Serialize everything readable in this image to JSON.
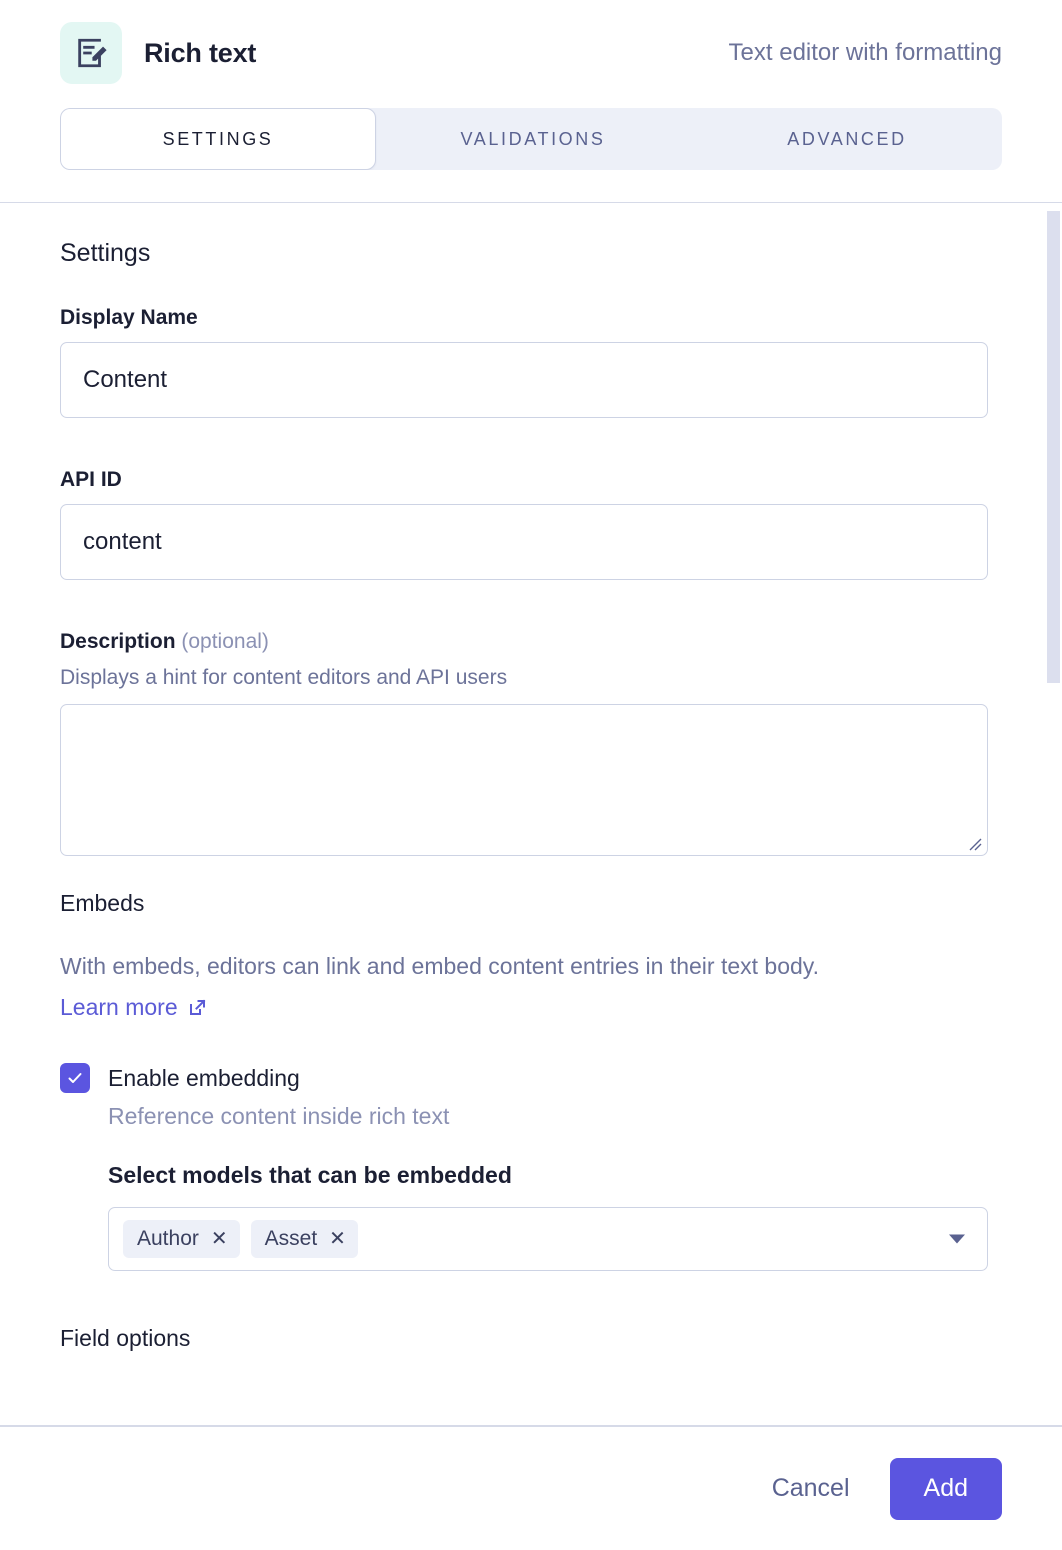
{
  "header": {
    "icon": "rich-text-document-pencil-icon",
    "title": "Rich text",
    "subtitle": "Text editor with formatting",
    "icon_bg": "#e3f7f3"
  },
  "tabs": [
    {
      "label": "SETTINGS",
      "active": true
    },
    {
      "label": "VALIDATIONS",
      "active": false
    },
    {
      "label": "ADVANCED",
      "active": false
    }
  ],
  "settings": {
    "heading": "Settings",
    "display_name": {
      "label": "Display Name",
      "value": "Content",
      "placeholder": ""
    },
    "api_id": {
      "label": "API ID",
      "value": "content",
      "placeholder": ""
    },
    "description": {
      "label": "Description",
      "optional": "(optional)",
      "hint": "Displays a hint for content editors and API users",
      "value": "",
      "placeholder": ""
    }
  },
  "embeds": {
    "heading": "Embeds",
    "paragraph": "With embeds, editors can link and embed content entries in their text body.",
    "learn_more": "Learn more",
    "learn_more_icon": "external-link-icon",
    "enable_checkbox": {
      "label": "Enable embedding",
      "sublabel": "Reference content inside rich text",
      "checked": true,
      "accent": "#5b55e0"
    },
    "models_label": "Select models that can be embedded",
    "selected_models": [
      "Author",
      "Asset"
    ],
    "remove_glyph": "✕",
    "caret_icon": "chevron-down-icon"
  },
  "field_options": {
    "heading": "Field options"
  },
  "footer": {
    "cancel_label": "Cancel",
    "add_label": "Add",
    "primary_color": "#5b55e0"
  }
}
